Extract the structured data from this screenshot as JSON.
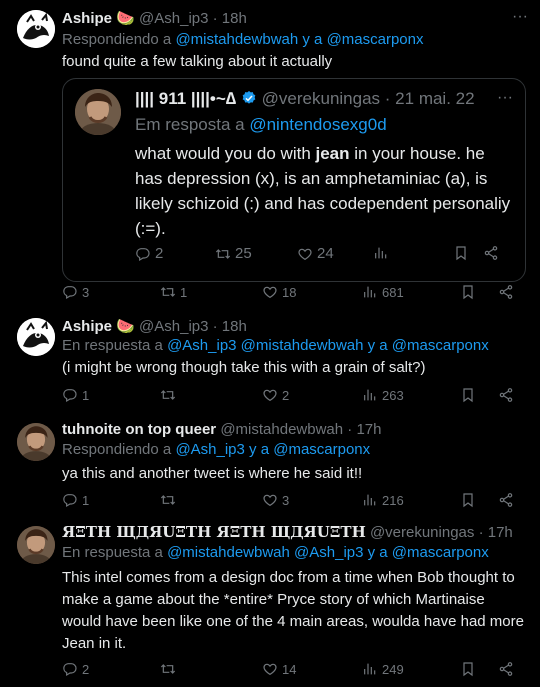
{
  "tweets": [
    {
      "name": "Ashipe 🍉",
      "handle": "@Ash_ip3",
      "time": "· 18h",
      "reply_prefix": "Respondiendo a",
      "reply_links": "@mistahdewbwah y a @mascarponx",
      "text": "found quite a few talking about it actually",
      "quote": {
        "name": "|||| 911 ||||•~∆",
        "handle": "@verekuningas",
        "time": "· 21 mai. 22",
        "reply_prefix": "Em resposta a",
        "reply_link": "@nintendosexg0d",
        "text_pre": "what would you do with ",
        "text_bold": "jean",
        "text_post": " in your house. he has depression (x), is an amphetaminiac (a), is likely schizoid (:) and has codependent personaliy (:=).",
        "replies": "2",
        "retweets": "25",
        "likes": "24"
      },
      "replies": "3",
      "retweets": "1",
      "likes": "18",
      "views": "681"
    },
    {
      "name": "Ashipe 🍉",
      "handle": "@Ash_ip3",
      "time": "· 18h",
      "reply_prefix": "En respuesta a",
      "reply_links": "@Ash_ip3 @mistahdewbwah y a @mascarponx",
      "text": "(i might be wrong though take this with a grain of salt?)",
      "replies": "1",
      "retweets": "",
      "likes": "2",
      "views": "263"
    },
    {
      "name": "tuhnoite on top queer",
      "handle": "@mistahdewbwah",
      "time": "· 17h",
      "reply_prefix": "Respondiendo a",
      "reply_links": "@Ash_ip3 y a @mascarponx",
      "text": "ya this and another tweet is where he said it!!",
      "replies": "1",
      "retweets": "",
      "likes": "3",
      "views": "216"
    },
    {
      "name": "ЯΞTH ЩДЯUΞTH ЯΞTH ЩДЯUΞTH",
      "handle": "@verekuningas",
      "time": "· 17h",
      "reply_prefix": "En respuesta a",
      "reply_links": "@mistahdewbwah @Ash_ip3 y a @mascarponx",
      "text": "This intel comes from a design doc from a time when Bob thought to make a game about the *entire* Pryce story of which Martinaise would have been like one of the 4 main areas, woulda have had more Jean in it.",
      "replies": "2",
      "retweets": "",
      "likes": "14",
      "views": "249"
    }
  ],
  "more_icon": "···",
  "colors": {
    "accent": "#1d9bf0",
    "muted": "#71767b",
    "text": "#e7e9ea",
    "border": "#2f3336"
  }
}
